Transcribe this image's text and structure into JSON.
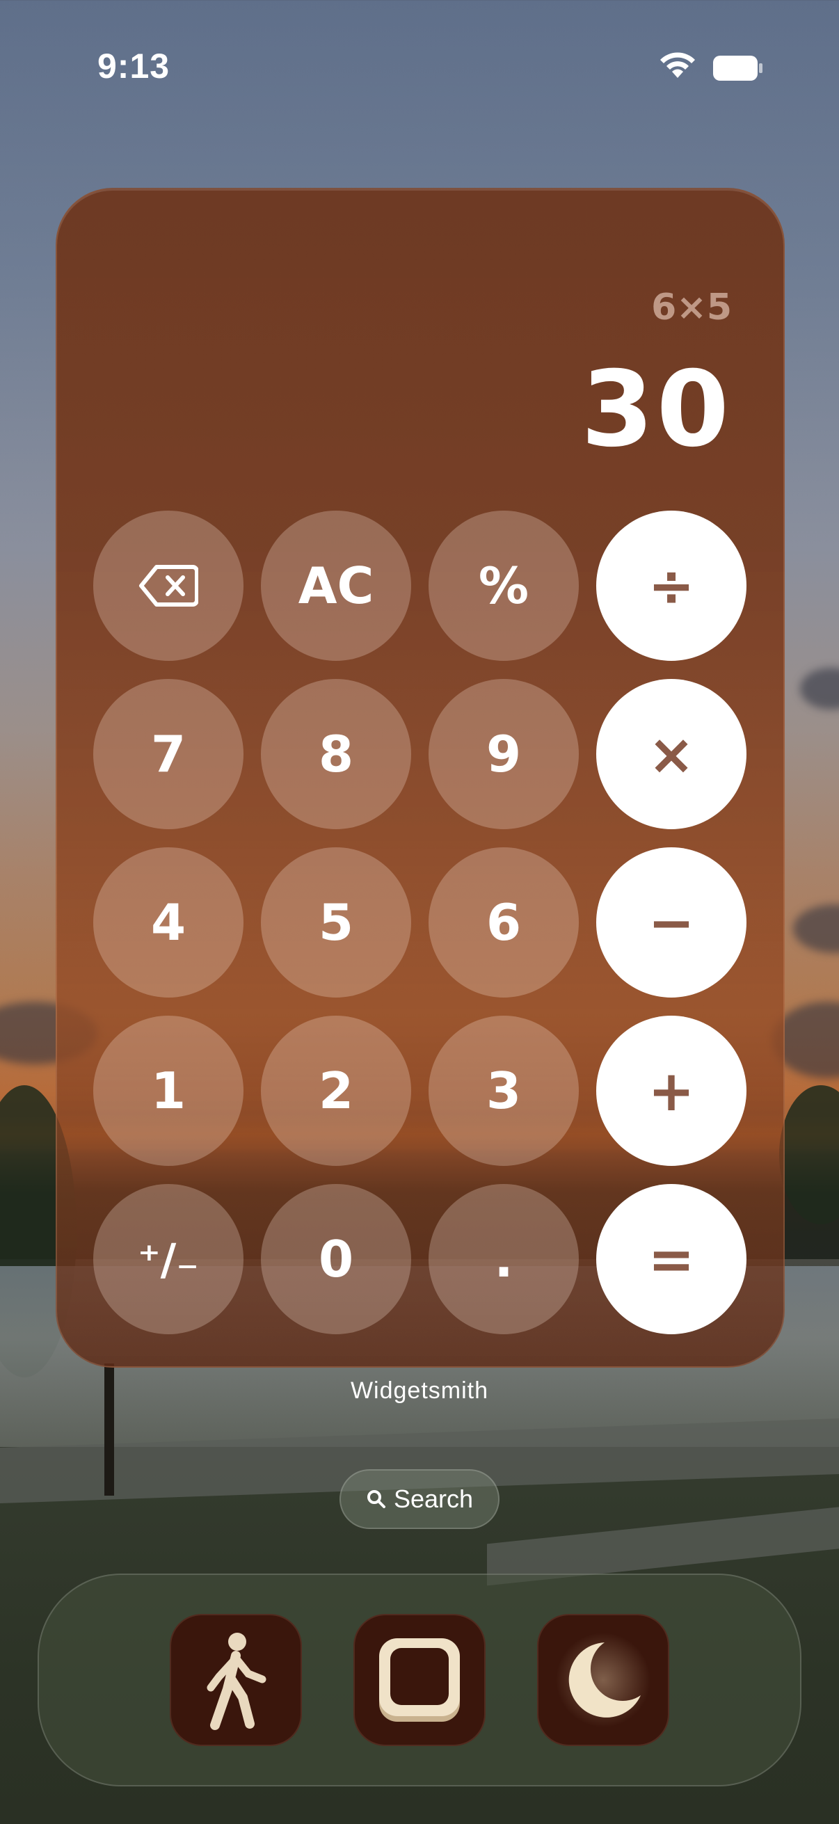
{
  "status_bar": {
    "time": "9:13"
  },
  "widget": {
    "expression": "6×5",
    "result": "30",
    "buttons": [
      {
        "id": "backspace",
        "label": ""
      },
      {
        "id": "clear",
        "label": "AC"
      },
      {
        "id": "percent",
        "label": "%"
      },
      {
        "id": "divide",
        "label": "÷"
      },
      {
        "id": "seven",
        "label": "7"
      },
      {
        "id": "eight",
        "label": "8"
      },
      {
        "id": "nine",
        "label": "9"
      },
      {
        "id": "multiply",
        "label": "×"
      },
      {
        "id": "four",
        "label": "4"
      },
      {
        "id": "five",
        "label": "5"
      },
      {
        "id": "six",
        "label": "6"
      },
      {
        "id": "minus",
        "label": "−"
      },
      {
        "id": "one",
        "label": "1"
      },
      {
        "id": "two",
        "label": "2"
      },
      {
        "id": "three",
        "label": "3"
      },
      {
        "id": "plus",
        "label": "+"
      },
      {
        "id": "sign",
        "label": "⁺∕₋"
      },
      {
        "id": "zero",
        "label": "0"
      },
      {
        "id": "decimal",
        "label": "."
      },
      {
        "id": "equals",
        "label": "="
      }
    ],
    "app_label": "Widgetsmith"
  },
  "search": {
    "label": "Search"
  },
  "dock": {
    "apps": [
      {
        "name": "walking-app",
        "icon": "walking-figure-icon"
      },
      {
        "name": "square-app",
        "icon": "rounded-square-icon"
      },
      {
        "name": "moon-app",
        "icon": "crescent-moon-icon"
      }
    ]
  },
  "colors": {
    "widget_bg": "#6e3820",
    "operator_button_bg": "#ffffff",
    "operator_text": "#8a5a47",
    "dock_icon_bg": "#3a160c",
    "dock_glyph": "#e9d9bf"
  }
}
